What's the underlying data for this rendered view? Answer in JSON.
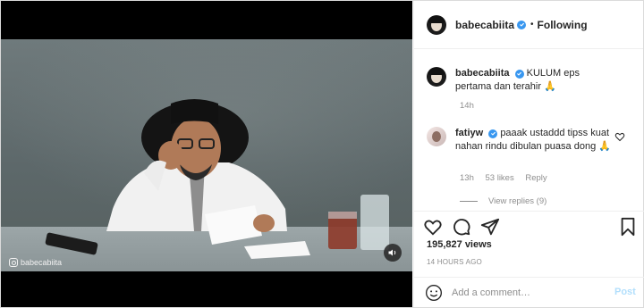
{
  "video": {
    "watermark": "babecabiita"
  },
  "post": {
    "author": "babecabiita",
    "separator": "•",
    "follow_state": "Following",
    "caption_user": "babecabiita",
    "caption_text": "KULUM eps pertama dan terahir 🙏",
    "caption_age": "14h"
  },
  "comments": [
    {
      "user": "fatiyw",
      "text": "paaak ustaddd tipss kuat nahan rindu dibulan puasa dong 🙏",
      "age": "13h",
      "likes": "53 likes",
      "reply": "Reply",
      "view_replies": "View replies (9)"
    }
  ],
  "stats": {
    "views": "195,827 views",
    "time_ago": "14 HOURS AGO"
  },
  "composer": {
    "placeholder": "Add a comment…",
    "post_label": "Post"
  },
  "colors": {
    "accent": "#3897f0",
    "post_disabled": "#b2dffc",
    "muted": "#8e8e8e"
  }
}
